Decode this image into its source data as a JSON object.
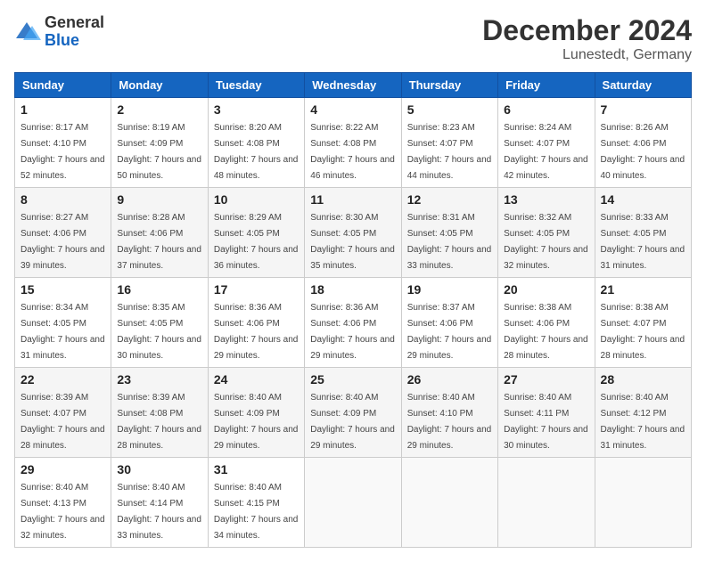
{
  "logo": {
    "general": "General",
    "blue": "Blue"
  },
  "header": {
    "month": "December 2024",
    "location": "Lunestedt, Germany"
  },
  "weekdays": [
    "Sunday",
    "Monday",
    "Tuesday",
    "Wednesday",
    "Thursday",
    "Friday",
    "Saturday"
  ],
  "weeks": [
    [
      {
        "day": "1",
        "sunrise": "8:17 AM",
        "sunset": "4:10 PM",
        "daylight": "7 hours and 52 minutes."
      },
      {
        "day": "2",
        "sunrise": "8:19 AM",
        "sunset": "4:09 PM",
        "daylight": "7 hours and 50 minutes."
      },
      {
        "day": "3",
        "sunrise": "8:20 AM",
        "sunset": "4:08 PM",
        "daylight": "7 hours and 48 minutes."
      },
      {
        "day": "4",
        "sunrise": "8:22 AM",
        "sunset": "4:08 PM",
        "daylight": "7 hours and 46 minutes."
      },
      {
        "day": "5",
        "sunrise": "8:23 AM",
        "sunset": "4:07 PM",
        "daylight": "7 hours and 44 minutes."
      },
      {
        "day": "6",
        "sunrise": "8:24 AM",
        "sunset": "4:07 PM",
        "daylight": "7 hours and 42 minutes."
      },
      {
        "day": "7",
        "sunrise": "8:26 AM",
        "sunset": "4:06 PM",
        "daylight": "7 hours and 40 minutes."
      }
    ],
    [
      {
        "day": "8",
        "sunrise": "8:27 AM",
        "sunset": "4:06 PM",
        "daylight": "7 hours and 39 minutes."
      },
      {
        "day": "9",
        "sunrise": "8:28 AM",
        "sunset": "4:06 PM",
        "daylight": "7 hours and 37 minutes."
      },
      {
        "day": "10",
        "sunrise": "8:29 AM",
        "sunset": "4:05 PM",
        "daylight": "7 hours and 36 minutes."
      },
      {
        "day": "11",
        "sunrise": "8:30 AM",
        "sunset": "4:05 PM",
        "daylight": "7 hours and 35 minutes."
      },
      {
        "day": "12",
        "sunrise": "8:31 AM",
        "sunset": "4:05 PM",
        "daylight": "7 hours and 33 minutes."
      },
      {
        "day": "13",
        "sunrise": "8:32 AM",
        "sunset": "4:05 PM",
        "daylight": "7 hours and 32 minutes."
      },
      {
        "day": "14",
        "sunrise": "8:33 AM",
        "sunset": "4:05 PM",
        "daylight": "7 hours and 31 minutes."
      }
    ],
    [
      {
        "day": "15",
        "sunrise": "8:34 AM",
        "sunset": "4:05 PM",
        "daylight": "7 hours and 31 minutes."
      },
      {
        "day": "16",
        "sunrise": "8:35 AM",
        "sunset": "4:05 PM",
        "daylight": "7 hours and 30 minutes."
      },
      {
        "day": "17",
        "sunrise": "8:36 AM",
        "sunset": "4:06 PM",
        "daylight": "7 hours and 29 minutes."
      },
      {
        "day": "18",
        "sunrise": "8:36 AM",
        "sunset": "4:06 PM",
        "daylight": "7 hours and 29 minutes."
      },
      {
        "day": "19",
        "sunrise": "8:37 AM",
        "sunset": "4:06 PM",
        "daylight": "7 hours and 29 minutes."
      },
      {
        "day": "20",
        "sunrise": "8:38 AM",
        "sunset": "4:06 PM",
        "daylight": "7 hours and 28 minutes."
      },
      {
        "day": "21",
        "sunrise": "8:38 AM",
        "sunset": "4:07 PM",
        "daylight": "7 hours and 28 minutes."
      }
    ],
    [
      {
        "day": "22",
        "sunrise": "8:39 AM",
        "sunset": "4:07 PM",
        "daylight": "7 hours and 28 minutes."
      },
      {
        "day": "23",
        "sunrise": "8:39 AM",
        "sunset": "4:08 PM",
        "daylight": "7 hours and 28 minutes."
      },
      {
        "day": "24",
        "sunrise": "8:40 AM",
        "sunset": "4:09 PM",
        "daylight": "7 hours and 29 minutes."
      },
      {
        "day": "25",
        "sunrise": "8:40 AM",
        "sunset": "4:09 PM",
        "daylight": "7 hours and 29 minutes."
      },
      {
        "day": "26",
        "sunrise": "8:40 AM",
        "sunset": "4:10 PM",
        "daylight": "7 hours and 29 minutes."
      },
      {
        "day": "27",
        "sunrise": "8:40 AM",
        "sunset": "4:11 PM",
        "daylight": "7 hours and 30 minutes."
      },
      {
        "day": "28",
        "sunrise": "8:40 AM",
        "sunset": "4:12 PM",
        "daylight": "7 hours and 31 minutes."
      }
    ],
    [
      {
        "day": "29",
        "sunrise": "8:40 AM",
        "sunset": "4:13 PM",
        "daylight": "7 hours and 32 minutes."
      },
      {
        "day": "30",
        "sunrise": "8:40 AM",
        "sunset": "4:14 PM",
        "daylight": "7 hours and 33 minutes."
      },
      {
        "day": "31",
        "sunrise": "8:40 AM",
        "sunset": "4:15 PM",
        "daylight": "7 hours and 34 minutes."
      },
      null,
      null,
      null,
      null
    ]
  ],
  "labels": {
    "sunrise": "Sunrise:",
    "sunset": "Sunset:",
    "daylight": "Daylight:"
  }
}
